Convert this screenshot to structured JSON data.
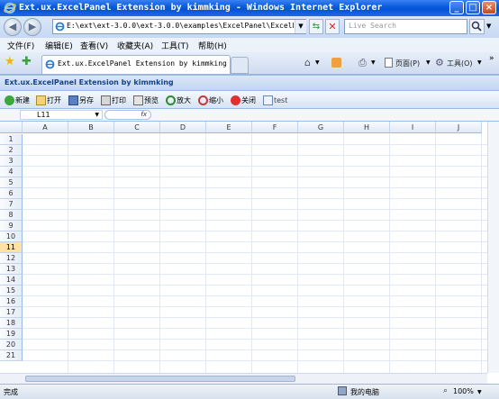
{
  "window": {
    "title": "Ext.ux.ExcelPanel Extension by kimmking - Windows Internet Explorer",
    "minimize": "_",
    "maximize": "□",
    "close": "×"
  },
  "address_bar": {
    "url": "E:\\ext\\ext-3.0.0\\ext-3.0.0\\examples\\ExcelPanel\\ExcelPanel.ht",
    "search_placeholder": "Live Search"
  },
  "menu": [
    "文件(F)",
    "编辑(E)",
    "查看(V)",
    "收藏夹(A)",
    "工具(T)",
    "帮助(H)"
  ],
  "tab": {
    "label": "Ext.ux.ExcelPanel Extension by kimmking"
  },
  "command_bar": {
    "page_label": "页面(P)",
    "tools_label": "工具(O)"
  },
  "panel": {
    "title": "Ext.ux.ExcelPanel Extension by kimmking",
    "toolbar": [
      "新建",
      "打开",
      "另存",
      "打印",
      "预览",
      "放大",
      "缩小",
      "关闭",
      "test"
    ],
    "cell_ref": "L11",
    "fx_label": "fx"
  },
  "grid": {
    "columns": [
      "A",
      "B",
      "C",
      "D",
      "E",
      "F",
      "G",
      "H",
      "I",
      "J"
    ],
    "rows": [
      "1",
      "2",
      "3",
      "4",
      "5",
      "6",
      "7",
      "8",
      "9",
      "10",
      "11",
      "12",
      "13",
      "14",
      "15",
      "16",
      "17",
      "18",
      "19",
      "20",
      "21"
    ],
    "selected_row": "11"
  },
  "status": {
    "left": "完成",
    "zone": "我的电脑",
    "zoom": "100%"
  },
  "colors": {
    "titlebar": "#0a5cde",
    "panel_border": "#99bbe8",
    "selected_row": "#fde2a4"
  }
}
